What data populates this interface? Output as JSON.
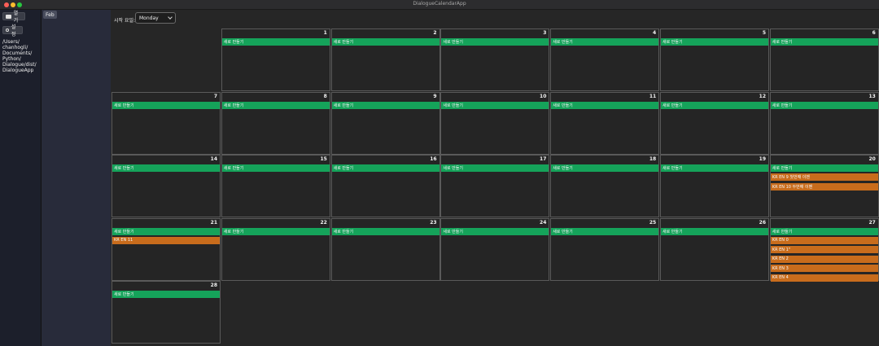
{
  "window": {
    "title": "DialogueCalendarApp"
  },
  "sidebar": {
    "open_label": "열기",
    "settings_label": "설정",
    "path": "/Users/chanhogli/Documents/Python/Dialogue/dist/DialogueApp",
    "path_lines": [
      "/Users/",
      "chanhogli/",
      "Documents/",
      "Python/",
      "Dialogue/dist/",
      "DialogueApp"
    ]
  },
  "months": [
    {
      "label": "Feb"
    }
  ],
  "toolbar": {
    "start_day_label": "시작 요일:",
    "start_day_value": "Monday"
  },
  "calendar": {
    "new_button_label": "새로 만들기",
    "days": [
      {
        "day": "1",
        "events": []
      },
      {
        "day": "2",
        "events": []
      },
      {
        "day": "3",
        "events": []
      },
      {
        "day": "4",
        "events": []
      },
      {
        "day": "5",
        "events": []
      },
      {
        "day": "6",
        "events": []
      },
      {
        "day": "7",
        "events": []
      },
      {
        "day": "8",
        "events": []
      },
      {
        "day": "9",
        "events": []
      },
      {
        "day": "10",
        "events": []
      },
      {
        "day": "11",
        "events": []
      },
      {
        "day": "12",
        "events": []
      },
      {
        "day": "13",
        "events": []
      },
      {
        "day": "14",
        "events": []
      },
      {
        "day": "15",
        "events": []
      },
      {
        "day": "16",
        "events": []
      },
      {
        "day": "17",
        "events": []
      },
      {
        "day": "18",
        "events": []
      },
      {
        "day": "19",
        "events": []
      },
      {
        "day": "20",
        "events": [
          "KR  EN  9 첫번째 이벤",
          "KR  EN  10 두번째 이벤"
        ]
      },
      {
        "day": "21",
        "events": [
          "KR  EN  11"
        ]
      },
      {
        "day": "22",
        "events": []
      },
      {
        "day": "23",
        "events": []
      },
      {
        "day": "24",
        "events": []
      },
      {
        "day": "25",
        "events": []
      },
      {
        "day": "26",
        "events": []
      },
      {
        "day": "27",
        "events": [
          "KR  EN  0",
          "KR  EN  1\"",
          "KR  EN  2",
          "KR  EN  3",
          "KR  EN  4"
        ]
      },
      {
        "day": "28",
        "events": []
      }
    ]
  },
  "colors": {
    "new_button": "#15a35a",
    "event": "#c86c1c",
    "sidebar": "#1c1f2b"
  }
}
